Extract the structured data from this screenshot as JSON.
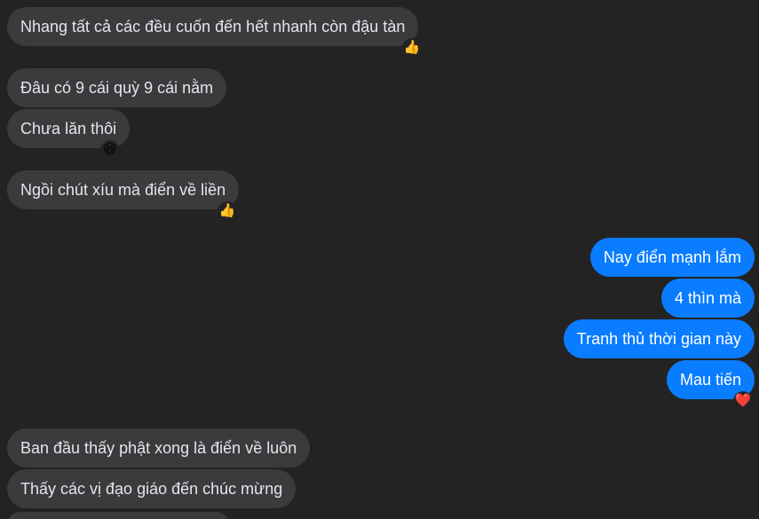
{
  "messages": {
    "incoming": [
      {
        "text": "Nhang tất cả các đều cuốn đến hết nhanh còn đậu tàn",
        "reaction": "👍"
      },
      {
        "text": "Đâu có 9 cái quỳ 9 cái nằm"
      },
      {
        "text": "Chưa lăn thôi",
        "reaction": "😆"
      },
      {
        "text": "Ngồi chút xíu mà điển về liền",
        "reaction": "👍"
      },
      {
        "text": "Ban đầu thấy phật xong là điển về luôn"
      },
      {
        "text": "Thấy các vị đạo giáo đến chúc mừng"
      }
    ],
    "outgoing": [
      {
        "text": "Nay điển mạnh lắm"
      },
      {
        "text": "4 thìn mà"
      },
      {
        "text": "Tranh thủ thời gian này"
      },
      {
        "text": "Mau tiến",
        "reaction": "❤️"
      }
    ]
  },
  "colors": {
    "background": "#232324",
    "incoming_bubble": "#3a3b3c",
    "outgoing_bubble": "#0a7cff"
  }
}
